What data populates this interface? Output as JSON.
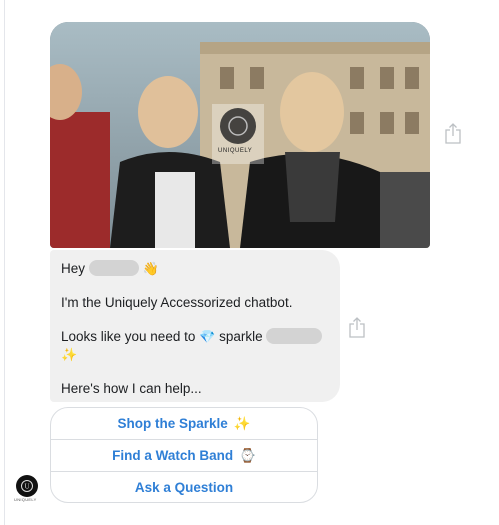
{
  "hero": {
    "icon": "logo-seal",
    "brand_watermark": "UNIQUELY"
  },
  "message": {
    "greeting": "Hey",
    "greeting_emoji": "👋",
    "intro": "I'm the Uniquely Accessorized chatbot.",
    "sparkle_prefix": "Looks like you need to",
    "sparkle_emoji": "💎",
    "sparkle_word": "sparkle",
    "sparkle_emoji2": "✨",
    "help": "Here's how I can help..."
  },
  "quick_replies": [
    {
      "label": "Shop the Sparkle",
      "icon": "✨"
    },
    {
      "label": "Find a Watch Band",
      "icon": "⌚"
    },
    {
      "label": "Ask a Question",
      "icon": ""
    }
  ],
  "avatar": {
    "caption": "UNIQUELY"
  },
  "colors": {
    "accent": "#2f7fd6",
    "bubble": "#f0f0f0",
    "border": "#dadde1"
  }
}
